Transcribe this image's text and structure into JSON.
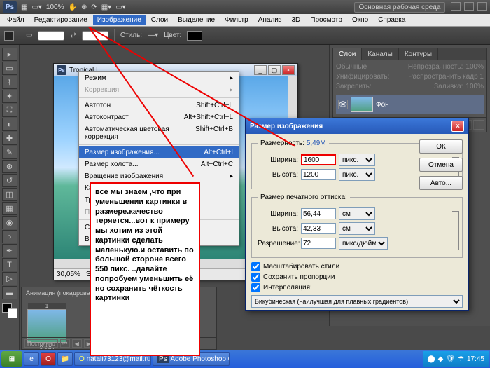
{
  "env_button": "Основная рабочая среда",
  "zoom_level": "100%",
  "menubar": [
    "Файл",
    "Редактирование",
    "Изображение",
    "Слои",
    "Выделение",
    "Фильтр",
    "Анализ",
    "3D",
    "Просмотр",
    "Окно",
    "Справка"
  ],
  "optbar": {
    "style": "Стиль:",
    "color": "Цвет:"
  },
  "doc": {
    "title": "Tropical I",
    "zoom": "30,05%",
    "status": "Экспо"
  },
  "dropdown": {
    "items": [
      {
        "label": "Режим",
        "arrow": true
      },
      {
        "label": "Коррекция",
        "arrow": true,
        "disabled": true
      },
      {
        "sep": true
      },
      {
        "label": "Автотон",
        "shortcut": "Shift+Ctrl+L"
      },
      {
        "label": "Автоконтраст",
        "shortcut": "Alt+Shift+Ctrl+L"
      },
      {
        "label": "Автоматическая цветовая коррекция",
        "shortcut": "Shift+Ctrl+B"
      },
      {
        "sep": true
      },
      {
        "label": "Размер изображения...",
        "shortcut": "Alt+Ctrl+I",
        "active": true
      },
      {
        "label": "Размер холста...",
        "shortcut": "Alt+Ctrl+C"
      },
      {
        "label": "Вращение изображения",
        "arrow": true
      },
      {
        "label": "Кадрировать"
      },
      {
        "label": "Тримминг..."
      },
      {
        "label": "Показать все",
        "disabled": true
      },
      {
        "sep": true
      },
      {
        "label": "Создать дубликат..."
      },
      {
        "label": "Внешний канал..."
      }
    ]
  },
  "dialog": {
    "title": "Размер изображения",
    "dim_label": "Размерность:",
    "dim_value": "5,49M",
    "width_label": "Ширина:",
    "width_value": "1600",
    "width_unit": "пикс.",
    "height_label": "Высота:",
    "height_value": "1200",
    "height_unit": "пикс.",
    "print_legend": "Размер печатного оттиска:",
    "pwidth_label": "Ширина:",
    "pwidth_value": "56,44",
    "pwidth_unit": "см",
    "pheight_label": "Высота:",
    "pheight_value": "42,33",
    "pheight_unit": "см",
    "res_label": "Разрешение:",
    "res_value": "72",
    "res_unit": "пикс/дюйм",
    "chk_scale": "Масштабировать стили",
    "chk_constrain": "Сохранить пропорции",
    "chk_interp": "Интерполяция:",
    "interp_method": "Бикубическая (наилучшая для плавных градиентов)",
    "ok": "ОК",
    "cancel": "Отмена",
    "auto": "Авто..."
  },
  "panels": {
    "tabs": [
      "Слои",
      "Каналы",
      "Контуры"
    ],
    "blend_label": "Обычные",
    "opacity_label": "Непрозрачность:",
    "opacity_val": "100%",
    "lock_label": "Закрепить:",
    "fill_label": "Заливка:",
    "fill_val": "100%",
    "unify_label": "Унифицировать:",
    "propagate": "Распространить кадр 1",
    "layer_name": "Фон"
  },
  "anim": {
    "title": "Анимация (покадровая)",
    "frame_time": "0 сек.",
    "frame_num": "1",
    "loop": "Постоянно"
  },
  "annotation": "все мы знаем ,что при уменьшении картинки в размере.качество теряется...вот к примеру мы хотим из этой картинки сделать маленькую.и оставить по большой стороне всего 550 пикс. ..давайте попробуем уменьшить её но сохранить чёткость картинки",
  "taskbar": {
    "items": [
      "natali73123@mail.ru:...",
      "Adobe Photoshop CS..."
    ],
    "time": "17:45"
  },
  "tools": [
    "▤",
    "▭",
    "⌕",
    "✥",
    "✂",
    "✎",
    "✚",
    "⟳",
    "⬚",
    "◉",
    "T",
    "➤",
    "⬡",
    "✋",
    "⊕"
  ]
}
